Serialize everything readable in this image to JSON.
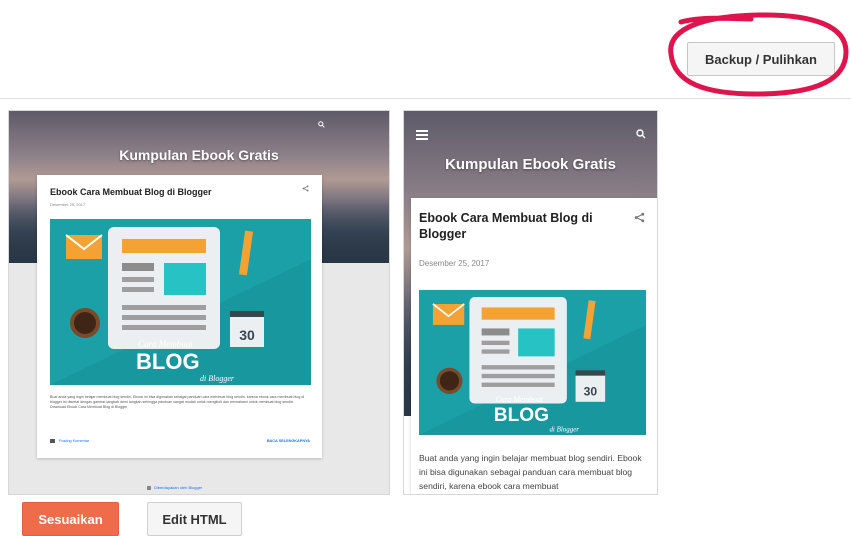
{
  "toolbar": {
    "backup_label": "Backup / Pulihkan"
  },
  "preview": {
    "blog_title": "Kumpulan Ebook Gratis",
    "post_title": "Ebook Cara Membuat Blog di Blogger",
    "desktop": {
      "date": "Desember 25, 2017",
      "excerpt": "Buat anda yang ingin belajar membuat blog sendiri. Ebook ini bisa digunakan sebagai panduan cara membuat blog sendiri, karena ebook cara membuat blog di blogger ini disertai dengan gambar-langkah demi langkah sehingga panduan sangat mudah untuk mengikuti dan memahami untuk membuat blog sendiri. Download Ebook Cara Membuat Blog di Blogger",
      "comment_link": "Posting Komentar",
      "read_more": "BACA SELENGKAPNYA",
      "powered_by": "Diberdayakan oleh Blogger"
    },
    "mobile": {
      "date": "Desember 25, 2017",
      "excerpt": "Buat anda yang ingin belajar membuat blog sendiri. Ebook ini bisa digunakan sebagai panduan cara membuat blog sendiri, karena ebook cara membuat"
    },
    "illustration": {
      "calendar_day": "30",
      "script_text": "Cara Membuat",
      "big_text": "BLOG",
      "sub_text": "di Blogger"
    }
  },
  "actions": {
    "customize_label": "Sesuaikan",
    "edit_html_label": "Edit HTML"
  },
  "colors": {
    "annotation": "#e0144c",
    "accent": "#ef6c4b",
    "illustration_bg": "#1ba0a8"
  }
}
